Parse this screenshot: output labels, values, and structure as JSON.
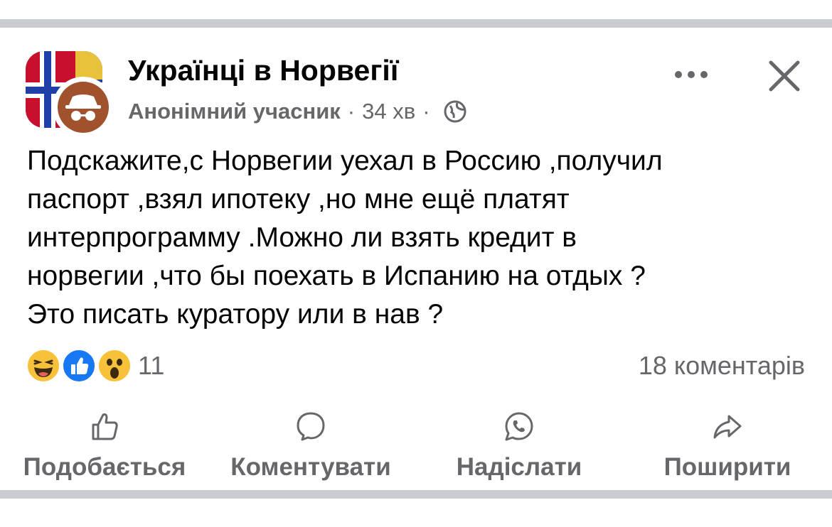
{
  "post": {
    "group_name": "Українці в Норвегії",
    "author": "Анонімний учасник",
    "separator": "·",
    "time": "34 хв",
    "body_lines": [
      "Подскажите,с Норвегии уехал в Россию ,получил",
      "паспорт ,взял ипотеку ,но мне ещё платят",
      "интерпрограмму .Можно ли взять кредит в",
      "норвегии ,что бы поехать в Испанию на отдых ?",
      "Это писать куратору или в нав ?"
    ],
    "reactions_count": "11",
    "comments_count": "18 коментарів"
  },
  "actions": {
    "like": "Подобається",
    "comment": "Коментувати",
    "send": "Надіслати",
    "share": "Поширити"
  },
  "icons": {
    "more": "more-horizontal-icon",
    "close": "close-icon",
    "privacy": "globe-icon",
    "reactions": [
      "haha-reaction-icon",
      "like-reaction-icon",
      "wow-reaction-icon"
    ]
  },
  "colors": {
    "text_primary": "#050505",
    "text_secondary": "#65676b",
    "like_blue": "#1877f2",
    "reaction_yellow": "#f7c23a",
    "separator_gray": "#c9cdd2"
  }
}
